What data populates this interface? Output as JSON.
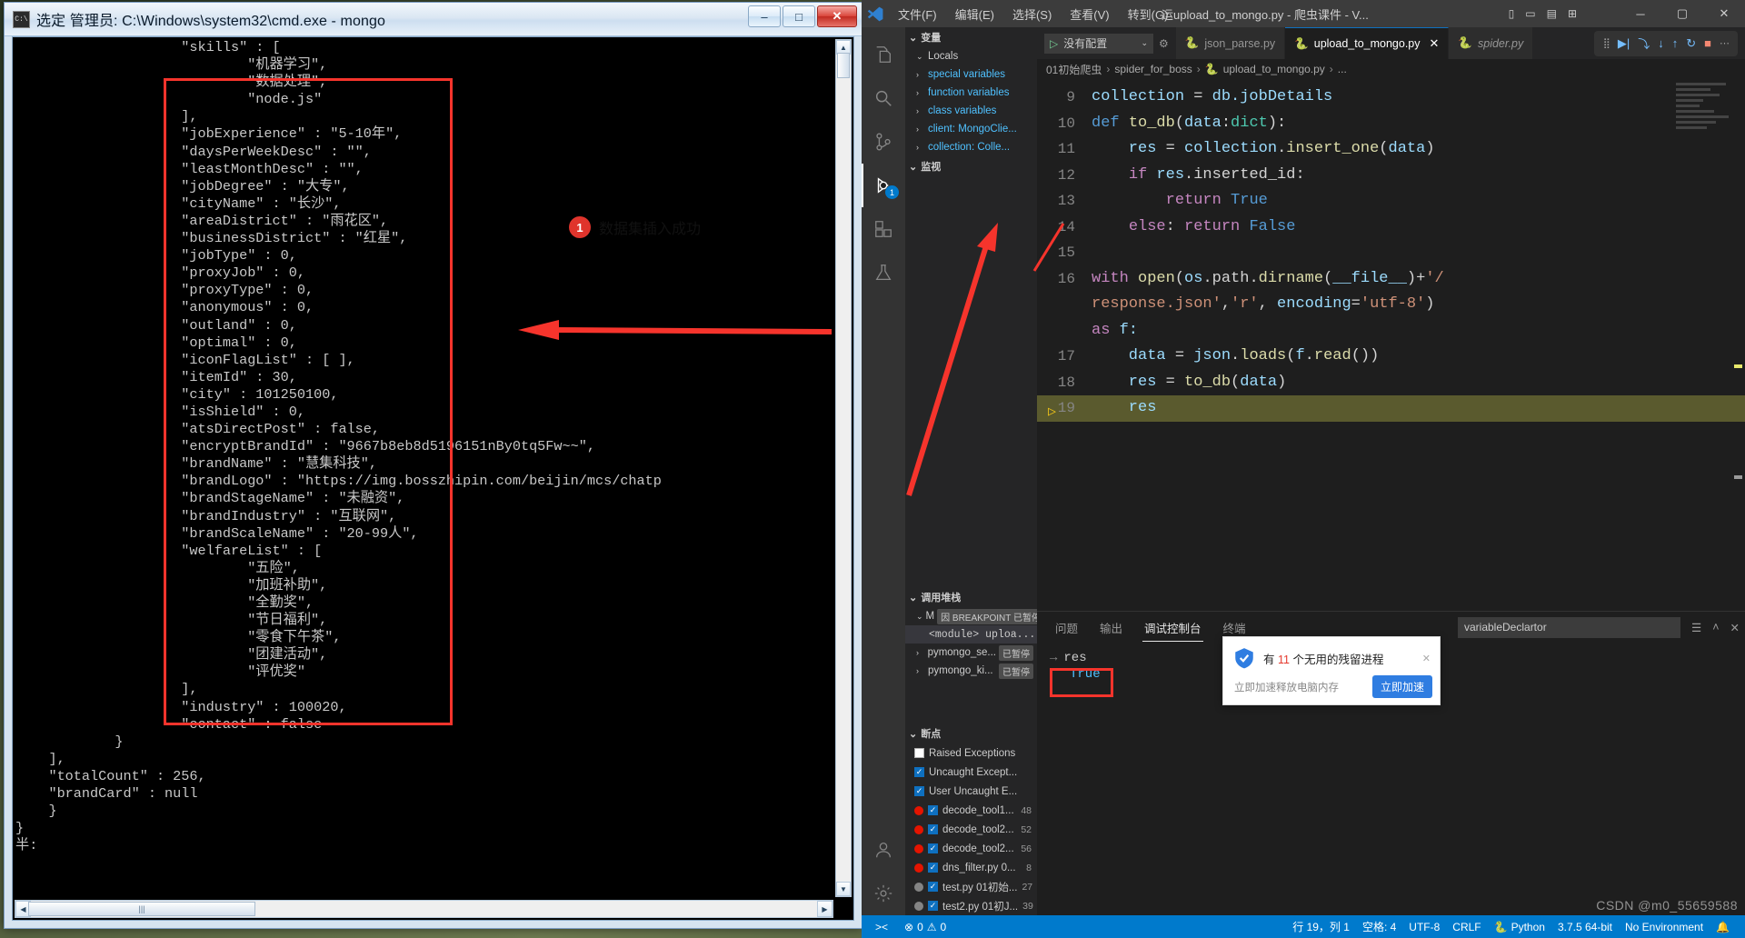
{
  "cmd": {
    "title": "选定 管理员: C:\\Windows\\system32\\cmd.exe - mongo",
    "icon_label": "C:\\",
    "minimize": "–",
    "maximize": "□",
    "close": "✕",
    "console_text": "                    \"skills\" : [\n                            \"机器学习\",\n                            \"数据处理\",\n                            \"node.js\"\n                    ],\n                    \"jobExperience\" : \"5-10年\",\n                    \"daysPerWeekDesc\" : \"\",\n                    \"leastMonthDesc\" : \"\",\n                    \"jobDegree\" : \"大专\",\n                    \"cityName\" : \"长沙\",\n                    \"areaDistrict\" : \"雨花区\",\n                    \"businessDistrict\" : \"红星\",\n                    \"jobType\" : 0,\n                    \"proxyJob\" : 0,\n                    \"proxyType\" : 0,\n                    \"anonymous\" : 0,\n                    \"outland\" : 0,\n                    \"optimal\" : 0,\n                    \"iconFlagList\" : [ ],\n                    \"itemId\" : 30,\n                    \"city\" : 101250100,\n                    \"isShield\" : 0,\n                    \"atsDirectPost\" : false,\n                    \"encryptBrandId\" : \"9667b8eb8d5196151nBy0tq5Fw~~\",\n                    \"brandName\" : \"慧集科技\",\n                    \"brandLogo\" : \"https://img.bosszhipin.com/beijin/mcs/chatp\n                    \"brandStageName\" : \"未融资\",\n                    \"brandIndustry\" : \"互联网\",\n                    \"brandScaleName\" : \"20-99人\",\n                    \"welfareList\" : [\n                            \"五险\",\n                            \"加班补助\",\n                            \"全勤奖\",\n                            \"节日福利\",\n                            \"零食下午茶\",\n                            \"团建活动\",\n                            \"评优奖\"\n                    ],\n                    \"industry\" : 100020,\n                    \"contact\" : false\n            }\n    ],\n    \"totalCount\" : 256,\n    \"brandCard\" : null\n    }\n}\n半:",
    "scroll_thumb_label": "|||"
  },
  "annotation": {
    "badge_number": "1",
    "badge_text": "数据集插入成功"
  },
  "vscode": {
    "menu": [
      "文件(F)",
      "编辑(E)",
      "选择(S)",
      "查看(V)",
      "转到(G)"
    ],
    "window_title": "运upload_to_mongo.py - 爬虫课件 - V...",
    "win_minimize": "─",
    "win_maximize": "▢",
    "win_close": "✕",
    "activity_icons": [
      {
        "name": "explorer-icon",
        "glyph": "🗎"
      },
      {
        "name": "search-icon",
        "glyph": "⌕"
      },
      {
        "name": "source-control-icon",
        "glyph": "⑂"
      },
      {
        "name": "run-and-debug-icon",
        "glyph": "▷",
        "badge": "1"
      },
      {
        "name": "extensions-icon",
        "glyph": "⊞"
      },
      {
        "name": "testing-icon",
        "glyph": "⚗"
      },
      {
        "name": "accounts-icon",
        "glyph": "☺"
      },
      {
        "name": "settings-gear-icon",
        "glyph": "⚙"
      }
    ],
    "debug_config_label": "没有配置",
    "tabs": [
      {
        "label": "json_parse.py",
        "active": false
      },
      {
        "label": "upload_to_mongo.py",
        "active": true
      },
      {
        "label": "spider.py",
        "active": false
      }
    ],
    "breadcrumb": [
      "01初始爬虫",
      "spider_for_boss",
      "upload_to_mongo.py",
      "..."
    ],
    "sidebar": {
      "variables_header": "变量",
      "locals_label": "Locals",
      "variable_rows": [
        "special variables",
        "function variables",
        "class variables",
        "client: MongoClie...",
        "collection: Colle..."
      ],
      "watch_header": "监视",
      "callstack_header": "调用堆栈",
      "callstack_rows": [
        {
          "label": "M",
          "badge": "因 BREAKPOINT 已暂停",
          "sel": false
        },
        {
          "label": "<module>  uploa...",
          "badge": "",
          "sel": true
        },
        {
          "label": "pymongo_se...",
          "badge": "已暂停",
          "sel": false
        },
        {
          "label": "pymongo_ki...",
          "badge": "已暂停",
          "sel": false
        }
      ],
      "breakpoints_header": "断点",
      "breakpoints": [
        {
          "label": "Raised Exceptions",
          "checked": false,
          "dot": "",
          "line": ""
        },
        {
          "label": "Uncaught Except...",
          "checked": true,
          "dot": "",
          "line": ""
        },
        {
          "label": "User Uncaught E...",
          "checked": true,
          "dot": "",
          "line": ""
        },
        {
          "label": "decode_tool1...",
          "checked": true,
          "dot": "red",
          "line": "48"
        },
        {
          "label": "decode_tool2...",
          "checked": true,
          "dot": "red",
          "line": "52"
        },
        {
          "label": "decode_tool2...",
          "checked": true,
          "dot": "red",
          "line": "56"
        },
        {
          "label": "dns_filter.py  0...",
          "checked": true,
          "dot": "red",
          "line": "8"
        },
        {
          "label": "test.py  01初始...",
          "checked": true,
          "dot": "hollow",
          "line": "27"
        },
        {
          "label": "test2.py  01初J...",
          "checked": true,
          "dot": "hollow",
          "line": "39"
        }
      ]
    },
    "code_lines": [
      {
        "num": "9",
        "bp": false,
        "hl": false,
        "tokens": [
          {
            "t": "collection ",
            "c": "var"
          },
          {
            "t": "= ",
            "c": "pl"
          },
          {
            "t": "db.jobDetails",
            "c": "var"
          }
        ]
      },
      {
        "num": "10",
        "bp": false,
        "hl": false,
        "tokens": [
          {
            "t": "def ",
            "c": "kw"
          },
          {
            "t": "to_db",
            "c": "fn"
          },
          {
            "t": "(",
            "c": "pl"
          },
          {
            "t": "data",
            "c": "var"
          },
          {
            "t": ":",
            "c": "pl"
          },
          {
            "t": "dict",
            "c": "bi"
          },
          {
            "t": "):",
            "c": "pl"
          }
        ]
      },
      {
        "num": "11",
        "bp": false,
        "hl": false,
        "tokens": [
          {
            "t": "    res ",
            "c": "var"
          },
          {
            "t": "= ",
            "c": "pl"
          },
          {
            "t": "collection",
            "c": "var"
          },
          {
            "t": ".",
            "c": "pl"
          },
          {
            "t": "insert_one",
            "c": "fn"
          },
          {
            "t": "(",
            "c": "pl"
          },
          {
            "t": "data",
            "c": "var"
          },
          {
            "t": ")",
            "c": "pl"
          }
        ]
      },
      {
        "num": "12",
        "bp": false,
        "hl": false,
        "tokens": [
          {
            "t": "    ",
            "c": "pl"
          },
          {
            "t": "if ",
            "c": "kw2"
          },
          {
            "t": "res",
            "c": "var"
          },
          {
            "t": ".inserted_id:",
            "c": "pl"
          }
        ]
      },
      {
        "num": "13",
        "bp": false,
        "hl": false,
        "tokens": [
          {
            "t": "        ",
            "c": "pl"
          },
          {
            "t": "return ",
            "c": "kw2"
          },
          {
            "t": "True",
            "c": "cst"
          }
        ]
      },
      {
        "num": "14",
        "bp": false,
        "hl": false,
        "tokens": [
          {
            "t": "    ",
            "c": "pl"
          },
          {
            "t": "else",
            "c": "kw2"
          },
          {
            "t": ": ",
            "c": "pl"
          },
          {
            "t": "return ",
            "c": "kw2"
          },
          {
            "t": "False",
            "c": "cst"
          }
        ]
      },
      {
        "num": "15",
        "bp": false,
        "hl": false,
        "tokens": []
      },
      {
        "num": "16",
        "bp": false,
        "hl": false,
        "tokens": [
          {
            "t": "with ",
            "c": "kw2"
          },
          {
            "t": "open",
            "c": "fn"
          },
          {
            "t": "(",
            "c": "pl"
          },
          {
            "t": "os",
            "c": "var"
          },
          {
            "t": ".path.",
            "c": "pl"
          },
          {
            "t": "dirname",
            "c": "fn"
          },
          {
            "t": "(",
            "c": "pl"
          },
          {
            "t": "__file__",
            "c": "var"
          },
          {
            "t": ")+",
            "c": "pl"
          },
          {
            "t": "'/",
            "c": "str"
          }
        ]
      },
      {
        "num": "",
        "bp": false,
        "hl": false,
        "tokens": [
          {
            "t": "response.json'",
            "c": "str"
          },
          {
            "t": ",",
            "c": "pl"
          },
          {
            "t": "'r'",
            "c": "str"
          },
          {
            "t": ", ",
            "c": "pl"
          },
          {
            "t": "encoding",
            "c": "var"
          },
          {
            "t": "=",
            "c": "pl"
          },
          {
            "t": "'utf-8'",
            "c": "str"
          },
          {
            "t": ")",
            "c": "pl"
          }
        ]
      },
      {
        "num": "",
        "bp": false,
        "hl": false,
        "tokens": [
          {
            "t": "as ",
            "c": "kw2"
          },
          {
            "t": "f:",
            "c": "var"
          }
        ]
      },
      {
        "num": "17",
        "bp": false,
        "hl": false,
        "tokens": [
          {
            "t": "    data ",
            "c": "var"
          },
          {
            "t": "= ",
            "c": "pl"
          },
          {
            "t": "json",
            "c": "var"
          },
          {
            "t": ".",
            "c": "pl"
          },
          {
            "t": "loads",
            "c": "fn"
          },
          {
            "t": "(",
            "c": "pl"
          },
          {
            "t": "f",
            "c": "var"
          },
          {
            "t": ".",
            "c": "pl"
          },
          {
            "t": "read",
            "c": "fn"
          },
          {
            "t": "())",
            "c": "pl"
          }
        ]
      },
      {
        "num": "18",
        "bp": false,
        "hl": false,
        "tokens": [
          {
            "t": "    res ",
            "c": "var"
          },
          {
            "t": "= ",
            "c": "pl"
          },
          {
            "t": "to_db",
            "c": "fn"
          },
          {
            "t": "(",
            "c": "pl"
          },
          {
            "t": "data",
            "c": "var"
          },
          {
            "t": ")",
            "c": "pl"
          }
        ]
      },
      {
        "num": "19",
        "bp": true,
        "hl": true,
        "tokens": [
          {
            "t": "    res",
            "c": "var"
          }
        ]
      }
    ],
    "panel": {
      "tabs": [
        "问题",
        "输出",
        "调试控制台",
        "终端"
      ],
      "active_tab": "调试控制台",
      "filter_value": "variableDeclartor",
      "repl_input": "res",
      "repl_output": "True",
      "panel_icons": {
        "more": "☰",
        "maximize": "˄",
        "close": "✕"
      }
    },
    "statusbar": {
      "errors": "0",
      "warnings": "0",
      "error_icon": "⊗",
      "warning_icon": "⚠",
      "remote_icon": "><",
      "position": "行 19，列 1",
      "spaces": "空格: 4",
      "encoding": "UTF-8",
      "eol": "CRLF",
      "language": "Python",
      "interpreter": "3.7.5 64-bit",
      "env": "No Environment",
      "bell_icon": "🔔"
    }
  },
  "popup": {
    "title_prefix": "有 ",
    "count": "11",
    "title_suffix": " 个无用的残留进程",
    "subtitle": "立即加速释放电脑内存",
    "button": "立即加速",
    "close": "✕"
  },
  "watermark": "CSDN @m0_55659588",
  "colors": {
    "accent_blue": "#007acc",
    "annotation_red": "#f6342c",
    "highlight_yellow": "#5a5a2e",
    "link_blue": "#4fc1ff"
  }
}
